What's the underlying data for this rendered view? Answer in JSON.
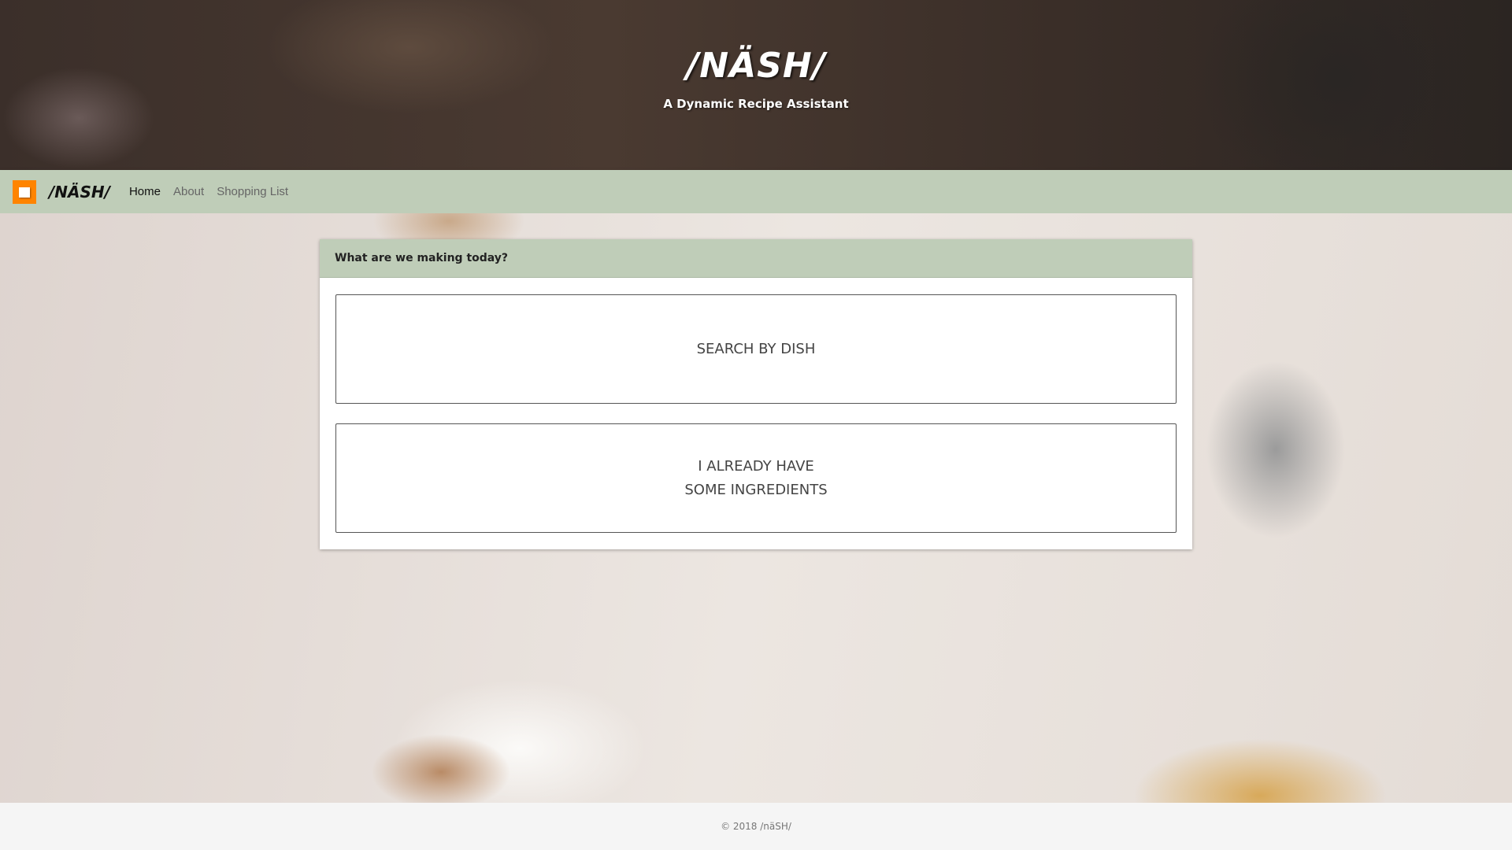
{
  "header": {
    "title": "/NÄSH/",
    "subtitle": "A Dynamic Recipe Assistant"
  },
  "nav": {
    "brand": "/NÄSH/",
    "items": [
      {
        "label": "Home",
        "active": true
      },
      {
        "label": "About"
      },
      {
        "label": "Shopping List"
      }
    ],
    "logo_color": "#ff8400",
    "bar_color": "#bfcdb8"
  },
  "card": {
    "heading": "What are we making today?",
    "buttons": [
      {
        "label": "SEARCH BY DISH"
      },
      {
        "line1": "I ALREADY HAVE",
        "line2": "SOME INGREDIENTS"
      }
    ]
  },
  "footer": {
    "text": "© 2018 /näSH/"
  }
}
